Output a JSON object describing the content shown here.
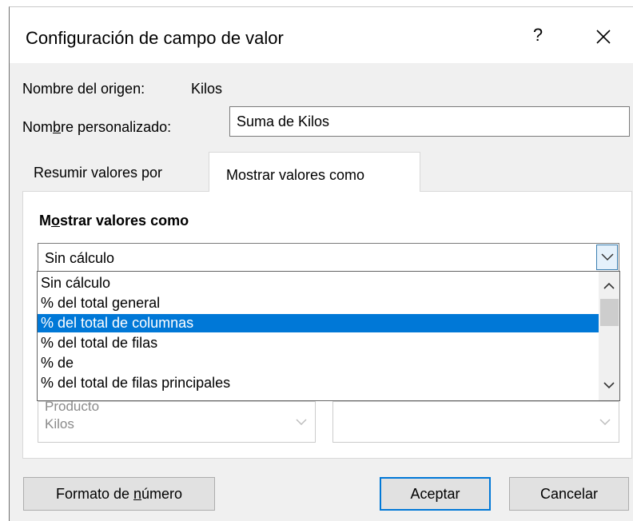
{
  "dialog": {
    "title": "Configuración de campo de valor",
    "help_label": "?",
    "close_label": "✕"
  },
  "source": {
    "label": "Nombre del origen:",
    "value": "Kilos"
  },
  "custom_name": {
    "label_pre": "Nom",
    "label_accel": "b",
    "label_post": "re personalizado:",
    "value": "Suma de Kilos"
  },
  "tabs": [
    {
      "label": "Resumir valores por",
      "active": false
    },
    {
      "label": "Mostrar valores como",
      "active": true
    }
  ],
  "panel": {
    "heading_pre": "M",
    "heading_accel": "o",
    "heading_post": "strar valores como",
    "selected_value": "Sin cálculo",
    "options": [
      "Sin cálculo",
      "% del total general",
      "% del total de columnas",
      "% del total de filas",
      "% de",
      "% del total de filas principales"
    ],
    "highlighted_index": 2,
    "base_field_items": [
      "Producto",
      "Kilos"
    ]
  },
  "buttons": {
    "format_pre": "Formato de ",
    "format_accel": "n",
    "format_post": "úmero",
    "ok": "Aceptar",
    "cancel": "Cancelar"
  },
  "colors": {
    "selection": "#0078d7",
    "dialog_bg": "#f0f0f0",
    "default_button_border": "#0078d7"
  }
}
